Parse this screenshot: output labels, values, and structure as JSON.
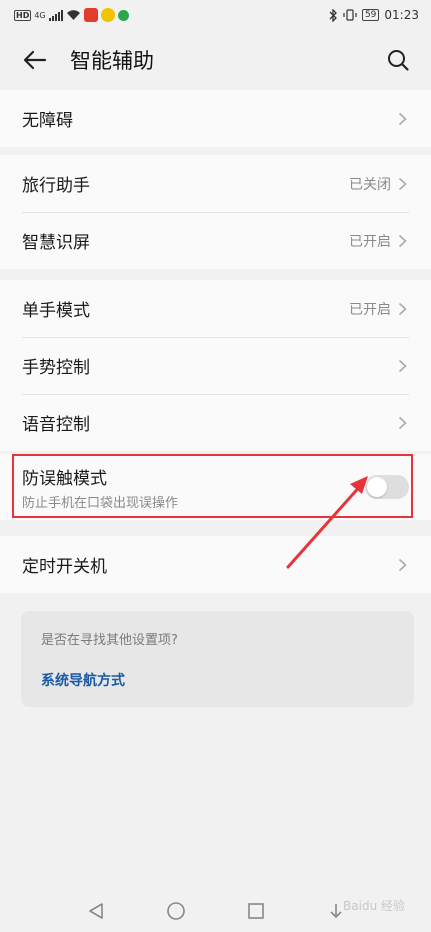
{
  "status_bar": {
    "hd": "HD",
    "net": "4G",
    "time": "01:23",
    "battery": "59"
  },
  "header": {
    "title": "智能辅助"
  },
  "groups": [
    {
      "items": [
        {
          "label": "无障碍",
          "status": ""
        }
      ]
    },
    {
      "items": [
        {
          "label": "旅行助手",
          "status": "已关闭"
        },
        {
          "label": "智慧识屏",
          "status": "已开启"
        }
      ]
    },
    {
      "items": [
        {
          "label": "单手模式",
          "status": "已开启"
        },
        {
          "label": "手势控制",
          "status": ""
        },
        {
          "label": "语音控制",
          "status": ""
        }
      ]
    }
  ],
  "pocket_mode": {
    "title": "防误触模式",
    "subtitle": "防止手机在口袋出现误操作",
    "enabled": false
  },
  "scheduled_power": {
    "label": "定时开关机"
  },
  "suggestion": {
    "question": "是否在寻找其他设置项?",
    "link": "系统导航方式"
  },
  "colors": {
    "highlight": "#e5353b",
    "link": "#1a5aa6"
  },
  "watermark": "Baidu 经验"
}
